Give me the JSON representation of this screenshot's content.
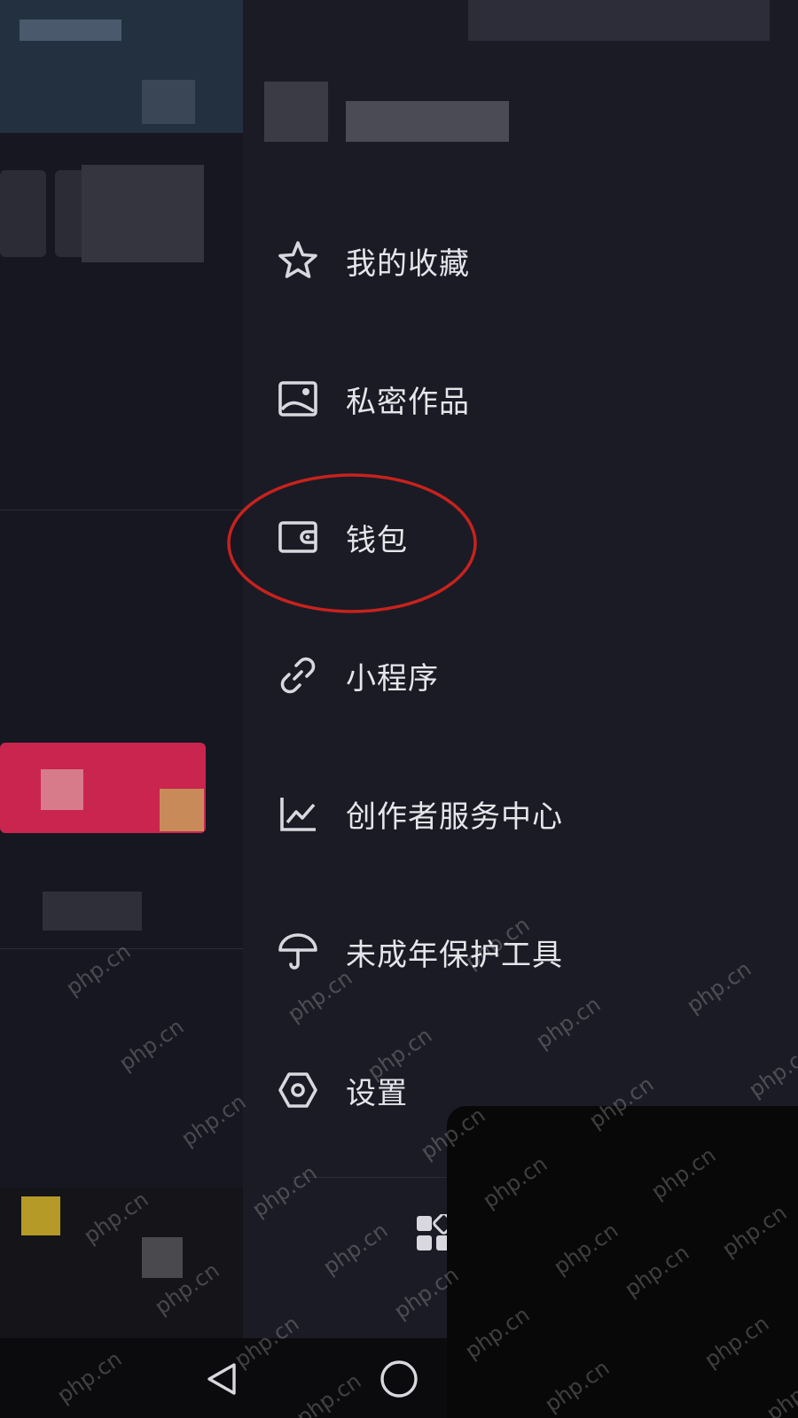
{
  "drawer": {
    "menu": [
      {
        "label": "我的收藏",
        "icon": "star-icon"
      },
      {
        "label": "私密作品",
        "icon": "image-icon"
      },
      {
        "label": "钱包",
        "icon": "wallet-icon"
      },
      {
        "label": "小程序",
        "icon": "link-icon"
      },
      {
        "label": "创作者服务中心",
        "icon": "chart-icon"
      },
      {
        "label": "未成年保护工具",
        "icon": "umbrella-icon"
      },
      {
        "label": "设置",
        "icon": "hexagon-settings-icon"
      }
    ],
    "bottom_icon": "grid-icon"
  },
  "annotation": {
    "highlight_color": "#c8221e"
  },
  "navbar": {
    "back_icon": "triangle-back-icon",
    "home_icon": "circle-home-icon"
  },
  "watermark": {
    "text": "php.cn"
  },
  "colors": {
    "drawer_bg": "#1a1b25",
    "text": "#e6e6ea",
    "icon": "#d8d8de",
    "pink_block": "#c9254f"
  }
}
